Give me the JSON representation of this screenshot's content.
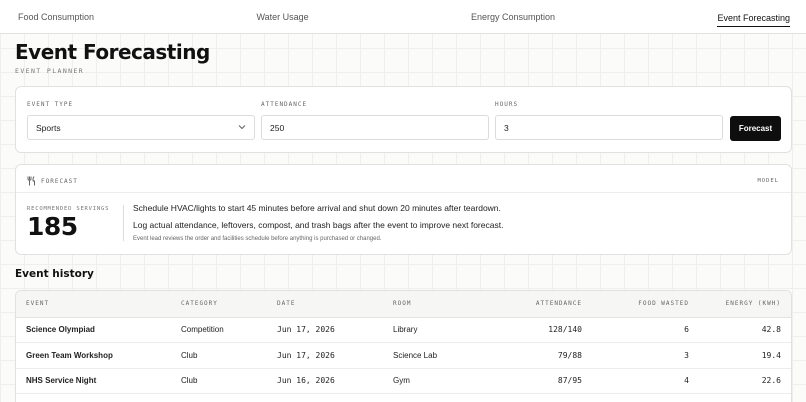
{
  "nav": {
    "tabs": [
      {
        "label": "Food Consumption"
      },
      {
        "label": "Water Usage"
      },
      {
        "label": "Energy Consumption"
      },
      {
        "label": "Event Forecasting"
      }
    ],
    "active_tab": "Event Forecasting"
  },
  "header": {
    "title": "Event Forecasting",
    "subtitle": "EVENT PLANNER"
  },
  "form": {
    "event_type": {
      "label": "EVENT TYPE",
      "value": "Sports"
    },
    "attendance": {
      "label": "ATTENDANCE",
      "value": "250"
    },
    "hours": {
      "label": "HOURS",
      "value": "3"
    },
    "submit_label": "Forecast"
  },
  "forecast": {
    "heading": "FORECAST",
    "model_label": "MODEL",
    "recommended_label": "RECOMMENDED SERVINGS",
    "recommended_value": "185",
    "notes": [
      "Schedule HVAC/lights to start 45 minutes before arrival and shut down 20 minutes after teardown.",
      "Log actual attendance, leftovers, compost, and trash bags after the event to improve next forecast."
    ],
    "disclaimer": "Event lead reviews the order and facilities schedule before anything is purchased or changed."
  },
  "history": {
    "title": "Event history",
    "columns": [
      "EVENT",
      "CATEGORY",
      "DATE",
      "ROOM",
      "ATTENDANCE",
      "FOOD WASTED",
      "ENERGY (KWH)"
    ],
    "rows": [
      {
        "event": "Science Olympiad",
        "category": "Competition",
        "date": "Jun 17, 2026",
        "room": "Library",
        "attendance": "128/140",
        "food_wasted": "6",
        "energy": "42.8"
      },
      {
        "event": "Green Team Workshop",
        "category": "Club",
        "date": "Jun 17, 2026",
        "room": "Science Lab",
        "attendance": "79/88",
        "food_wasted": "3",
        "energy": "19.4"
      },
      {
        "event": "NHS Service Night",
        "category": "Club",
        "date": "Jun 16, 2026",
        "room": "Gym",
        "attendance": "87/95",
        "food_wasted": "4",
        "energy": "22.6"
      }
    ]
  },
  "icons": {
    "forecast": "utensils-icon",
    "dropdown": "chevron-down-icon"
  }
}
